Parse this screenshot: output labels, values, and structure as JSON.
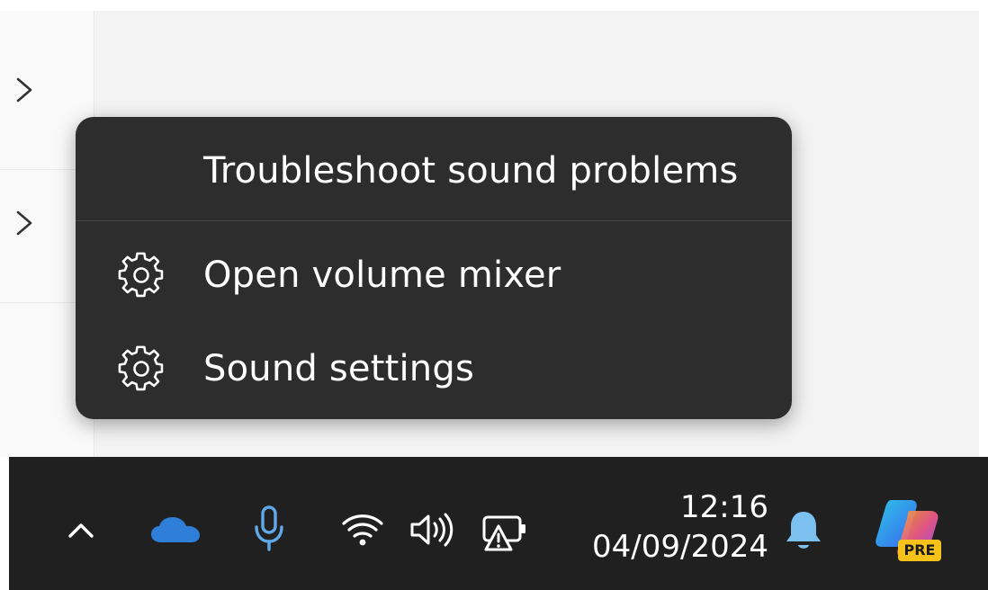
{
  "context_menu": {
    "items": [
      {
        "label": "Troubleshoot sound problems",
        "icon": null
      },
      {
        "label": "Open volume mixer",
        "icon": "gear-icon"
      },
      {
        "label": "Sound settings",
        "icon": "gear-icon"
      }
    ]
  },
  "taskbar": {
    "time": "12:16",
    "date": "04/09/2024",
    "copilot_badge": "PRE",
    "icons": [
      "chevron-up-icon",
      "onedrive-cloud-icon",
      "microphone-icon",
      "wifi-icon",
      "speaker-icon",
      "battery-warning-icon",
      "notification-bell-icon",
      "copilot-icon"
    ]
  },
  "colors": {
    "menu_bg": "#2d2d2d",
    "taskbar_bg": "#202020",
    "onedrive": "#2f7fd8",
    "mic": "#60a8e8",
    "bell": "#7cc0f0"
  }
}
